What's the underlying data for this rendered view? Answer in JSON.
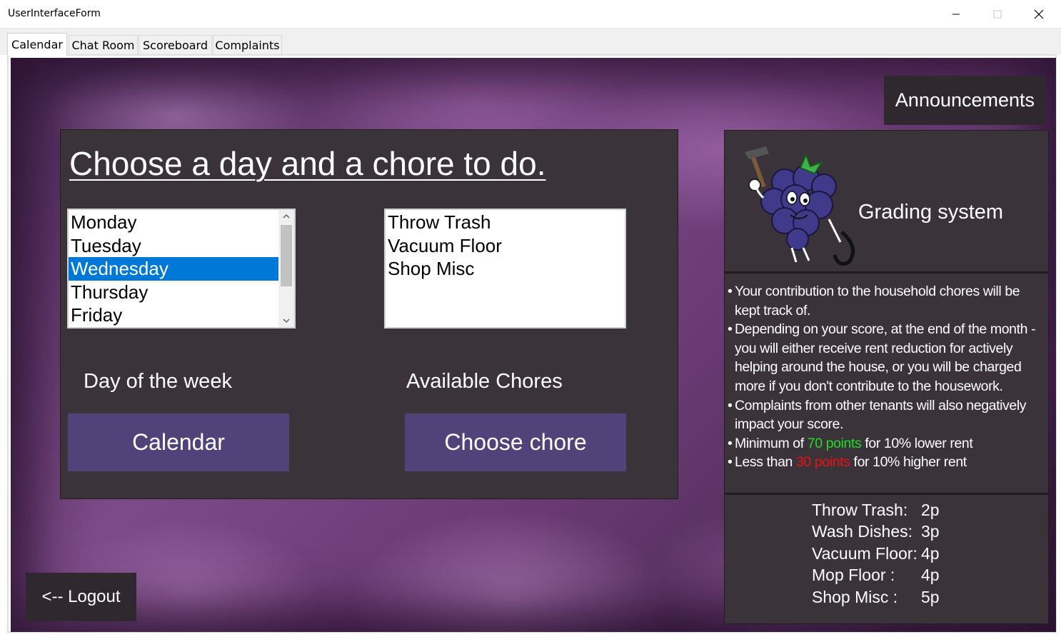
{
  "window": {
    "title": "UserInterfaceForm"
  },
  "tabs": [
    {
      "label": "Calendar",
      "active": true
    },
    {
      "label": "Chat Room",
      "active": false
    },
    {
      "label": "Scoreboard",
      "active": false
    },
    {
      "label": "Complaints",
      "active": false
    }
  ],
  "announcements_label": "Announcements",
  "main": {
    "heading": "Choose a day and a chore to do.",
    "days": {
      "items": [
        "Monday",
        "Tuesday",
        "Wednesday",
        "Thursday",
        "Friday"
      ],
      "selected": "Wednesday"
    },
    "chores": {
      "items": [
        "Throw Trash",
        "Vacuum Floor",
        "Shop Misc"
      ]
    },
    "day_label": "Day of the week",
    "chores_label": "Available Chores",
    "calendar_button": "Calendar",
    "choose_chore_button": "Choose chore"
  },
  "grading": {
    "title": "Grading system",
    "rules": [
      {
        "bullet": "•",
        "text": "Your contribution to the household  chores will be kept track of."
      },
      {
        "bullet": "•",
        "text": "Depending on your score, at the end of the month - you will either receive rent reduction for actively helping around the house, or you will be charged more if you don't contribute to the housework."
      },
      {
        "bullet": "•",
        "text": "Complaints from other tenants will also negatively impact your score."
      }
    ],
    "min_rule": {
      "bullet": "•",
      "before": "Minimum of ",
      "highlight": "70 points",
      "after": " for 10% lower rent"
    },
    "less_rule": {
      "bullet": "•",
      "before": "Less than ",
      "highlight": "30 points",
      "after": " for 10% higher rent"
    },
    "points": [
      {
        "chore": "Throw Trash:",
        "value": "2p"
      },
      {
        "chore": "Wash Dishes:",
        "value": "3p"
      },
      {
        "chore": "Vacuum Floor:",
        "value": "4p"
      },
      {
        "chore": "Mop Floor :",
        "value": "4p"
      },
      {
        "chore": "Shop Misc :",
        "value": "5p"
      }
    ]
  },
  "logout_label": "<--   Logout",
  "colors": {
    "card": "#3a3339",
    "button": "#51437a",
    "selection": "#0078d7",
    "good": "#22dd22",
    "bad": "#ee1111"
  },
  "icons": [
    "minimize-icon",
    "maximize-icon",
    "close-icon",
    "chevron-up-icon",
    "chevron-down-icon",
    "grape-mascot-icon"
  ]
}
